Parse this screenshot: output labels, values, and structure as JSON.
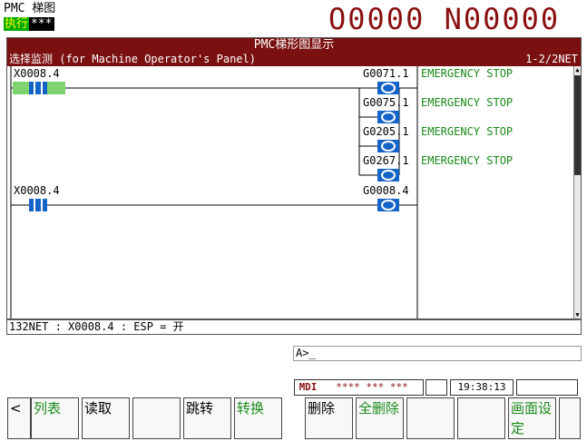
{
  "header": {
    "title": "PMC 梯图",
    "mode": "执行",
    "mode_stars": "***",
    "program_number": "O0000 N00000"
  },
  "window": {
    "title": "PMC梯形图显示",
    "subtitle": "选择监测 (for Machine Operator's Panel)",
    "net_range": "1-2/2NET"
  },
  "ladder": {
    "rung1": {
      "contact": "X0008.4",
      "coils": [
        {
          "addr": "G0071.1",
          "comment": "EMERGENCY STOP"
        },
        {
          "addr": "G0075.1",
          "comment": "EMERGENCY STOP"
        },
        {
          "addr": "G0205.1",
          "comment": "EMERGENCY STOP"
        },
        {
          "addr": "G0267.1",
          "comment": "EMERGENCY STOP"
        }
      ]
    },
    "rung2": {
      "contact": "X0008.4",
      "coil": "G0008.4"
    }
  },
  "status_line": "132NET : X0008.4 : ESP = 开",
  "input": {
    "prompt": "A>_"
  },
  "state_bar": {
    "mode": "MDI",
    "status": "**** *** ***",
    "time": "19:38:13"
  },
  "softkeys": [
    {
      "label": "<",
      "color": "#000000"
    },
    {
      "label": "列表",
      "color": "#1a8a1a"
    },
    {
      "label": "读取",
      "color": "#000000"
    },
    {
      "label": "",
      "color": "#000000"
    },
    {
      "label": "跳转",
      "color": "#000000"
    },
    {
      "label": "转换",
      "color": "#1a8a1a"
    },
    {
      "label": "删除",
      "color": "#000000"
    },
    {
      "label": "全删除",
      "color": "#1a8a1a"
    },
    {
      "label": "",
      "color": "#000000"
    },
    {
      "label": "",
      "color": "#000000"
    },
    {
      "label": "画面设定",
      "color": "#1a8a1a"
    },
    {
      "label": "",
      "color": "#000000"
    }
  ],
  "colors": {
    "title_bar": "#7b1010",
    "comment_text": "#1a8a1a",
    "coil_fill": "#1464c8",
    "active_contact": "#7ed36e"
  }
}
